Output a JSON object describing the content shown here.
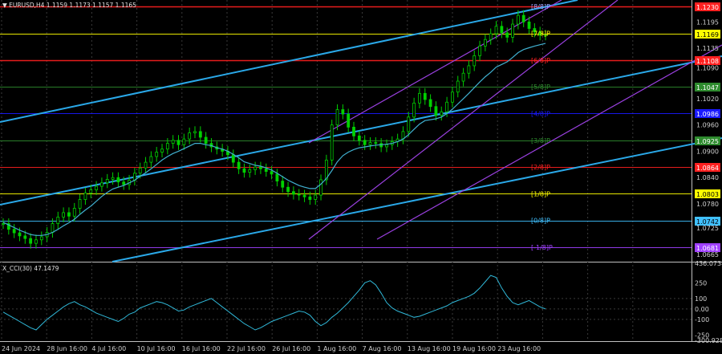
{
  "window": {
    "symbol_header": "▼ EURUSD,H4  1.1159 1.1173 1.1157 1.1165",
    "indicator_header": "X_CCI(30) 47.1479"
  },
  "chart_data": {
    "type": "line",
    "main": {
      "ylim": [
        1.065,
        1.1245
      ],
      "price_axis_ticks": [
        "1.1195",
        "1.1135",
        "1.1090",
        "1.1020",
        "1.0960",
        "1.0900",
        "1.0840",
        "1.0780",
        "1.0725",
        "1.0665"
      ],
      "price_tags": [
        {
          "value": 1.123,
          "label": "1.1230",
          "color": "#ff2020",
          "text_color": "#ffffff"
        },
        {
          "value": 1.1169,
          "label": "1.1169",
          "color": "#ffff00",
          "text_color": "#000000"
        },
        {
          "value": 1.1108,
          "label": "1.1108",
          "color": "#ff2020",
          "text_color": "#ffffff"
        },
        {
          "value": 1.1047,
          "label": "1.1047",
          "color": "#2e8b2e",
          "text_color": "#ffffff"
        },
        {
          "value": 1.0986,
          "label": "1.0986",
          "color": "#1a1aff",
          "text_color": "#ffffff"
        },
        {
          "value": 1.0925,
          "label": "1.0925",
          "color": "#2e8b2e",
          "text_color": "#ffffff"
        },
        {
          "value": 1.0864,
          "label": "1.0864",
          "color": "#ff2020",
          "text_color": "#ffffff"
        },
        {
          "value": 1.0803,
          "label": "1.0803",
          "color": "#ffff00",
          "text_color": "#000000"
        },
        {
          "value": 1.0742,
          "label": "1.0742",
          "color": "#40c0ff",
          "text_color": "#000000"
        },
        {
          "value": 1.0681,
          "label": "1.0681",
          "color": "#a040ff",
          "text_color": "#ffffff"
        }
      ],
      "murrey_labels": [
        {
          "value": 1.123,
          "label": "[8/8]P",
          "color": "#a0a0ff"
        },
        {
          "value": 1.1169,
          "label": "[7/8]P",
          "color": "#ffff00"
        },
        {
          "value": 1.1108,
          "label": "[6/8]P",
          "color": "#ff2020"
        },
        {
          "value": 1.1047,
          "label": "[5/8]P",
          "color": "#2e8b2e"
        },
        {
          "value": 1.0986,
          "label": "[4/8]P",
          "color": "#1a1aff"
        },
        {
          "value": 1.0925,
          "label": "[3/8]P",
          "color": "#2e8b2e"
        },
        {
          "value": 1.0864,
          "label": "[2/8]P",
          "color": "#ff2020"
        },
        {
          "value": 1.0803,
          "label": "[1/8]P",
          "color": "#ffff00"
        },
        {
          "value": 1.0742,
          "label": "[0/8]P",
          "color": "#40c0ff"
        },
        {
          "value": 1.0681,
          "label": "[-1/8]P",
          "color": "#a040ff"
        }
      ],
      "price": [
        1.0735,
        1.0722,
        1.0714,
        1.0707,
        1.0701,
        1.069,
        1.0698,
        1.0705,
        1.0715,
        1.0735,
        1.075,
        1.076,
        1.0752,
        1.077,
        1.079,
        1.0805,
        1.0812,
        1.082,
        1.0828,
        1.0836,
        1.084,
        1.083,
        1.0824,
        1.0834,
        1.085,
        1.0862,
        1.0875,
        1.0888,
        1.0898,
        1.0905,
        1.0918,
        1.0925,
        1.0915,
        1.0928,
        1.0942,
        1.0945,
        1.0932,
        1.0918,
        1.091,
        1.0905,
        1.09,
        1.0892,
        1.0875,
        1.086,
        1.0852,
        1.0858,
        1.0864,
        1.086,
        1.0854,
        1.0848,
        1.0832,
        1.0818,
        1.0808,
        1.0802,
        1.08,
        1.0796,
        1.079,
        1.08,
        1.0835,
        1.088,
        1.096,
        1.0995,
        1.0985,
        1.0955,
        1.0935,
        1.0925,
        1.0915,
        1.092,
        1.0918,
        1.091,
        1.0915,
        1.0922,
        1.0928,
        1.0945,
        1.0978,
        1.101,
        1.1032,
        1.1018,
        1.1002,
        1.0982,
        1.099,
        1.1012,
        1.1035,
        1.106,
        1.1078,
        1.1095,
        1.1118,
        1.114,
        1.1155,
        1.1168,
        1.1185,
        1.117,
        1.116,
        1.119,
        1.121,
        1.1195,
        1.118,
        1.1172,
        1.1165,
        1.1165
      ],
      "ma": [
        1.0738,
        1.0732,
        1.0726,
        1.072,
        1.0715,
        1.071,
        1.0708,
        1.0708,
        1.071,
        1.0715,
        1.0722,
        1.073,
        1.0737,
        1.0745,
        1.0756,
        1.0766,
        1.0775,
        1.0786,
        1.0797,
        1.0806,
        1.0814,
        1.0818,
        1.0822,
        1.0828,
        1.0834,
        1.0843,
        1.0851,
        1.086,
        1.087,
        1.088,
        1.0888,
        1.0895,
        1.09,
        1.0906,
        1.0912,
        1.0918,
        1.0918,
        1.0915,
        1.0913,
        1.0908,
        1.0905,
        1.09,
        1.0893,
        1.0885,
        1.0876,
        1.0872,
        1.0868,
        1.0866,
        1.0862,
        1.0857,
        1.085,
        1.0842,
        1.0834,
        1.0828,
        1.0822,
        1.0818,
        1.0815,
        1.0815,
        1.0825,
        1.0838,
        1.0856,
        1.0876,
        1.089,
        1.0898,
        1.0904,
        1.0908,
        1.091,
        1.0912,
        1.0914,
        1.0915,
        1.0916,
        1.0918,
        1.0922,
        1.0928,
        1.0938,
        1.095,
        1.0962,
        1.097,
        1.0972,
        1.0974,
        1.0978,
        1.0986,
        1.0996,
        1.1008,
        1.102,
        1.1032,
        1.1045,
        1.1058,
        1.107,
        1.108,
        1.1092,
        1.1098,
        1.1104,
        1.1114,
        1.1125,
        1.1132,
        1.1136,
        1.114,
        1.1143,
        1.1146
      ]
    },
    "indicator": {
      "name": "X_CCI(30)",
      "ylim": [
        -300,
        436
      ],
      "axis_ticks": [
        "436.0738",
        "250",
        "100",
        "0.00",
        "-100",
        "-250",
        "-300.9282"
      ],
      "values": [
        -30,
        -60,
        -90,
        -120,
        -150,
        -180,
        -200,
        -150,
        -100,
        -60,
        -20,
        20,
        50,
        70,
        40,
        20,
        -10,
        -40,
        -60,
        -80,
        -100,
        -120,
        -90,
        -50,
        -30,
        10,
        30,
        50,
        70,
        60,
        40,
        10,
        -20,
        -10,
        20,
        40,
        60,
        80,
        100,
        60,
        20,
        -20,
        -60,
        -100,
        -140,
        -170,
        -200,
        -180,
        -150,
        -120,
        -100,
        -80,
        -60,
        -40,
        -20,
        -30,
        -60,
        -120,
        -160,
        -130,
        -80,
        -40,
        10,
        60,
        120,
        180,
        250,
        270,
        230,
        150,
        60,
        10,
        -20,
        -40,
        -60,
        -80,
        -70,
        -50,
        -30,
        -10,
        10,
        30,
        60,
        80,
        100,
        120,
        150,
        200,
        260,
        320,
        300,
        200,
        120,
        60,
        40,
        60,
        80,
        50,
        20,
        0
      ]
    },
    "x_axis_labels": [
      "24 Jun 2024",
      "28 Jun 16:00",
      "4 Jul 16:00",
      "10 Jul 16:00",
      "16 Jul 16:00",
      "22 Jul 16:00",
      "26 Jul 16:00",
      "1 Aug 16:00",
      "7 Aug 16:00",
      "13 Aug 16:00",
      "19 Aug 16:00",
      "23 Aug 16:00"
    ],
    "grid": true
  }
}
